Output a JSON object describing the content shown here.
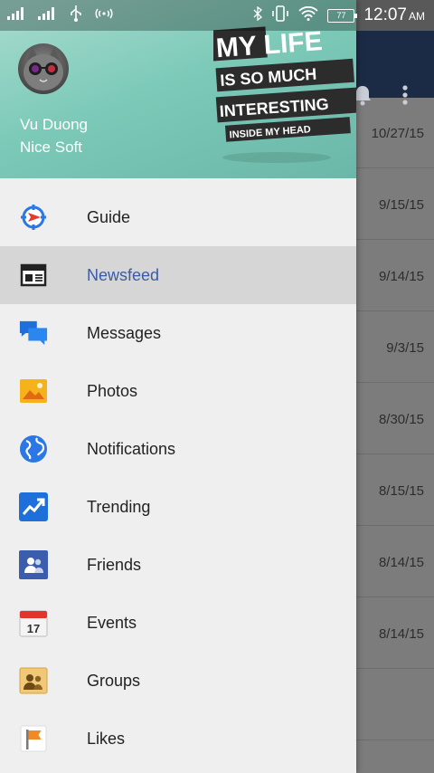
{
  "status_bar": {
    "time": "12:07",
    "ampm": "AM",
    "battery": "77"
  },
  "colors": {
    "drawer_bg": "#efefef",
    "active_item_bg": "#d6d6d6",
    "active_label": "#3a5ba8",
    "app_bar": "#1c2b45",
    "header_teal": "#7ecab9"
  },
  "header": {
    "user_name": "Vu Duong",
    "user_subtitle": "Nice Soft",
    "art_lines": [
      "MY LIFE",
      "IS SO MUCH",
      "INTERESTING",
      "INSIDE MY HEAD"
    ]
  },
  "menu": {
    "items": [
      {
        "label": "Guide",
        "icon": "compass-icon"
      },
      {
        "label": "Newsfeed",
        "icon": "newsfeed-icon",
        "active": true
      },
      {
        "label": "Messages",
        "icon": "chat-bubbles-icon"
      },
      {
        "label": "Photos",
        "icon": "photo-icon"
      },
      {
        "label": "Notifications",
        "icon": "globe-icon"
      },
      {
        "label": "Trending",
        "icon": "trend-chart-icon"
      },
      {
        "label": "Friends",
        "icon": "friends-icon"
      },
      {
        "label": "Events",
        "icon": "calendar-icon",
        "badge": "17"
      },
      {
        "label": "Groups",
        "icon": "groups-icon"
      },
      {
        "label": "Likes",
        "icon": "flag-icon"
      }
    ]
  },
  "background_list": {
    "dates": [
      "10/27/15",
      "9/15/15",
      "9/14/15",
      "9/3/15",
      "8/30/15",
      "8/15/15",
      "8/14/15",
      "8/14/15"
    ]
  }
}
